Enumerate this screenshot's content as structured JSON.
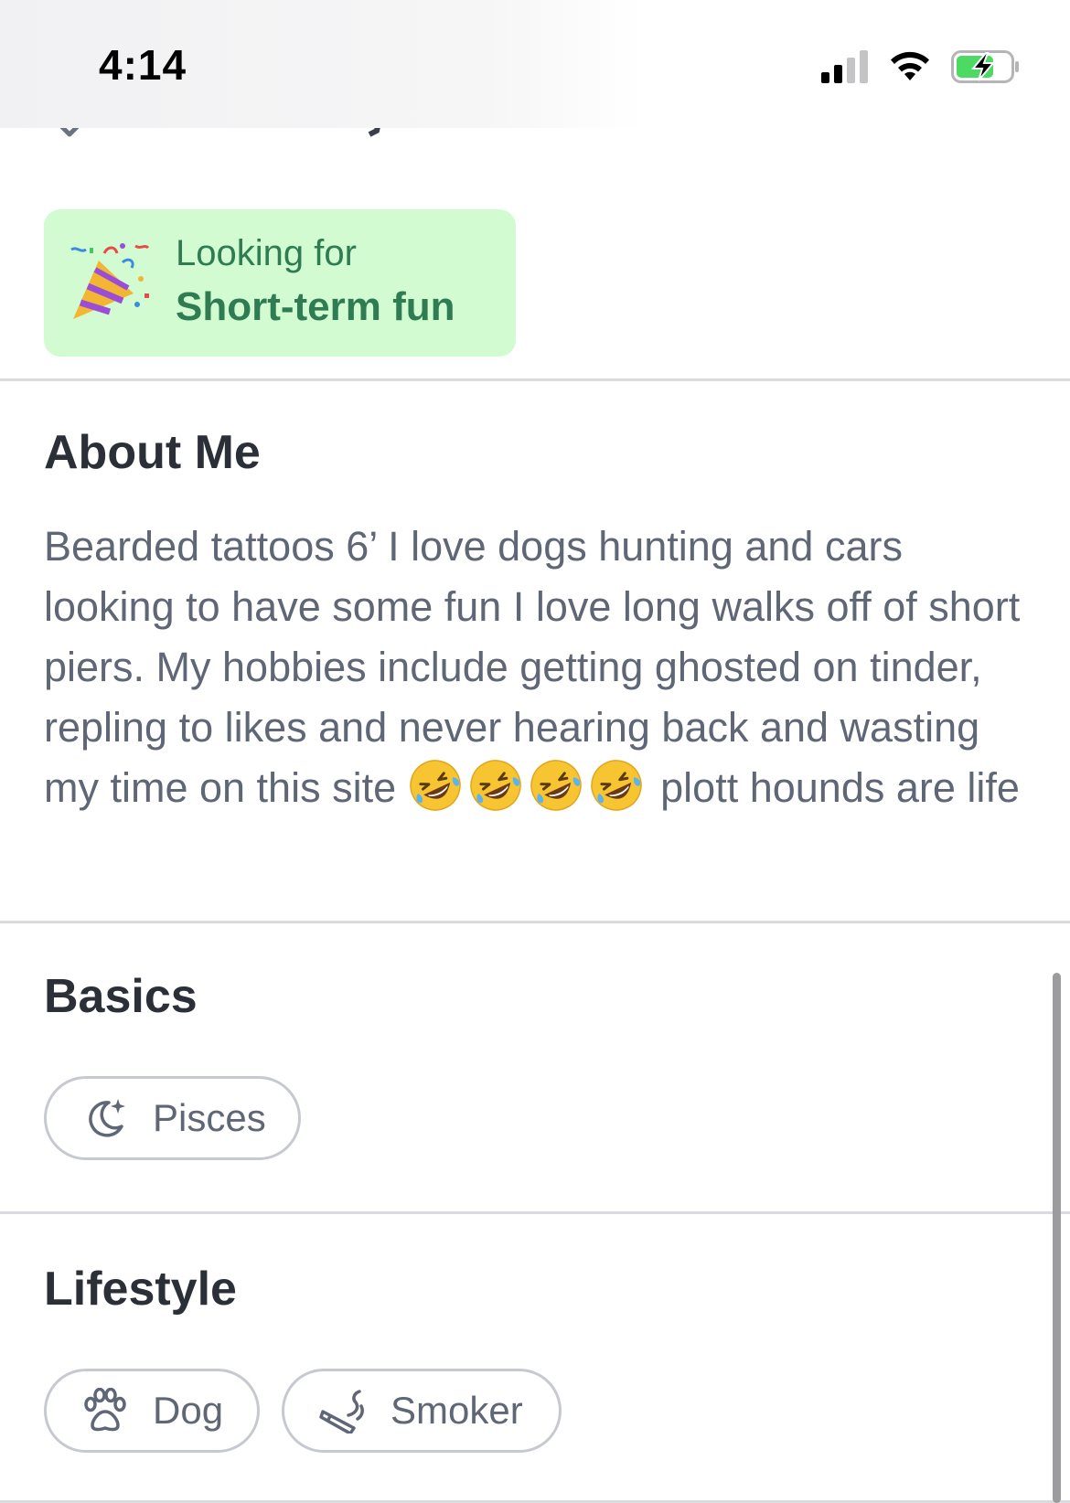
{
  "status_bar": {
    "time": "4:14",
    "battery_color": "#4cd964"
  },
  "looking_for": {
    "label": "Looking for",
    "value": "Short-term fun",
    "icon": "party-popper-icon",
    "background": "#d2fbd2",
    "text_color": "#2f7c52"
  },
  "about": {
    "title": "About Me",
    "text_before_emojis": "Bearded tattoos 6’ I love dogs hunting and cars looking to have some fun I love long walks off of short piers. My hobbies include getting ghosted on tinder, repling to likes and never hearing back and wasting my time on this site",
    "emojis": [
      "🤣",
      "🤣",
      "🤣",
      "🤣"
    ],
    "text_after_emojis": "plott hounds are life"
  },
  "basics": {
    "title": "Basics",
    "chips": [
      {
        "label": "Pisces",
        "icon": "moon-stars-icon"
      }
    ]
  },
  "lifestyle": {
    "title": "Lifestyle",
    "chips": [
      {
        "label": "Dog",
        "icon": "paw-icon"
      },
      {
        "label": "Smoker",
        "icon": "cigarette-icon"
      }
    ]
  }
}
